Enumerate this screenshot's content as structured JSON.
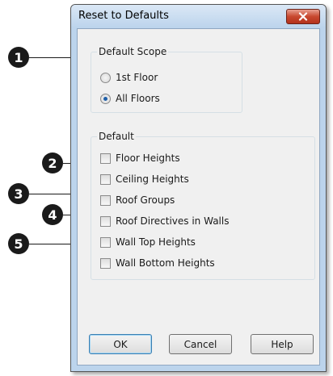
{
  "window": {
    "title": "Reset to Defaults"
  },
  "scope_group": {
    "label": "Default Scope",
    "options": [
      {
        "label": "1st Floor",
        "checked": false
      },
      {
        "label": "All Floors",
        "checked": true
      }
    ]
  },
  "default_group": {
    "label": "Default",
    "items": [
      {
        "label": "Floor Heights",
        "checked": false
      },
      {
        "label": "Ceiling Heights",
        "checked": false
      },
      {
        "label": "Roof Groups",
        "checked": false
      },
      {
        "label": "Roof Directives in Walls",
        "checked": false
      },
      {
        "label": "Wall Top Heights",
        "checked": false
      },
      {
        "label": "Wall Bottom Heights",
        "checked": false
      }
    ]
  },
  "buttons": {
    "ok": "OK",
    "cancel": "Cancel",
    "help": "Help"
  },
  "callouts": [
    "1",
    "2",
    "3",
    "4",
    "5"
  ],
  "colors": {
    "accent": "#1f5fa8",
    "close": "#c8482f",
    "frame": "#bcd4ec"
  }
}
